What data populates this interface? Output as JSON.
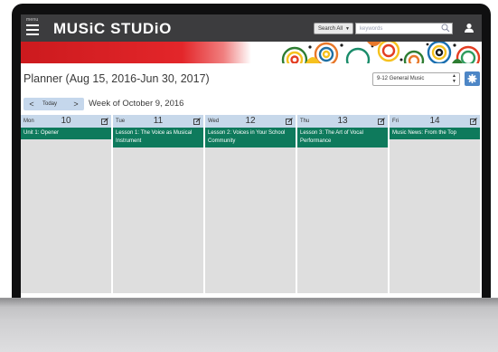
{
  "header": {
    "menu_label": "menu",
    "logo": "MUSiC STUDiO",
    "search_scope": "Search All",
    "search_placeholder": "keywords"
  },
  "planner": {
    "title": "Planner (Aug 15, 2016-Jun 30, 2017)",
    "course": "9-12 General Music",
    "today_label": "Today",
    "prev_symbol": "<",
    "next_symbol": ">",
    "week_label": "Week of October 9, 2016"
  },
  "days": [
    {
      "name": "Mon",
      "num": "10",
      "event": "Unit 1: Opener"
    },
    {
      "name": "Tue",
      "num": "11",
      "event": "Lesson 1: The Voice as Musical Instrument"
    },
    {
      "name": "Wed",
      "num": "12",
      "event": "Lesson 2: Voices in Your School Community"
    },
    {
      "name": "Thu",
      "num": "13",
      "event": "Lesson 3: The Art of Vocal Performance"
    },
    {
      "name": "Fri",
      "num": "14",
      "event": "Music News: From the Top"
    }
  ],
  "colors": {
    "topbar": "#3c3c3e",
    "banner_red": "#e3262a",
    "event_green": "#0e7a5c",
    "day_header": "#c7d8ea",
    "accent_blue": "#4d86c6"
  },
  "icons": [
    "menu-icon",
    "search-icon",
    "user-icon",
    "gear-icon",
    "edit-icon",
    "chevron-left-icon",
    "chevron-right-icon"
  ]
}
